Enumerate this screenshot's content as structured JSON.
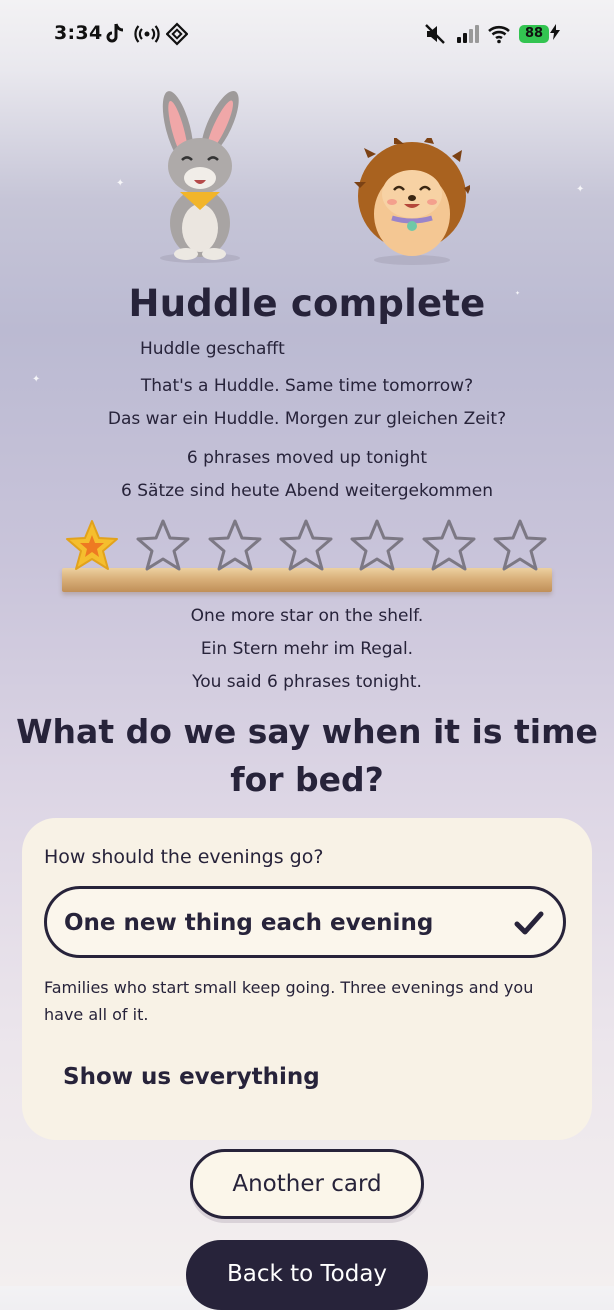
{
  "status_bar": {
    "time": "3:34",
    "icons": [
      "tiktok-icon",
      "broadcast-icon",
      "app-diamond-icon",
      "mute-icon",
      "cellular-signal-icon",
      "wifi-icon",
      "battery-icon",
      "charging-bolt-icon"
    ],
    "battery_level": "88"
  },
  "mascots": [
    "bunny-mascot",
    "hedgehog-mascot"
  ],
  "header": {
    "title": "Huddle complete",
    "subtitle": "Huddle geschafft"
  },
  "messages": {
    "line1_en": "That's a Huddle. Same time tomorrow?",
    "line1_de": "Das war ein Huddle. Morgen zur gleichen Zeit?",
    "line2_en": "6 phrases moved up tonight",
    "line2_de": "6 Sätze sind heute Abend weitergekommen"
  },
  "star_shelf": {
    "total_stars": 7,
    "earned_stars": 1,
    "star_color": "#f5be2e",
    "empty_star_color": "#7c7884"
  },
  "shelf_messages": {
    "en": "One more star on the shelf.",
    "de": "Ein Stern mehr im Regal.",
    "phrases": "You said 6 phrases tonight."
  },
  "question": {
    "text": "What do we say when it is time for bed?"
  },
  "evening_card": {
    "prompt": "How should the evenings go?",
    "selected_option": "One new thing each evening",
    "note": "Families who start small keep going. Three evenings and you have all of it.",
    "other_option": "Show us everything"
  },
  "buttons": {
    "another_card": "Another card",
    "back_to_today": "Back to Today"
  },
  "colors": {
    "ink": "#27233a",
    "card_bg": "#f8f2e6",
    "battery_green": "#33c451"
  }
}
